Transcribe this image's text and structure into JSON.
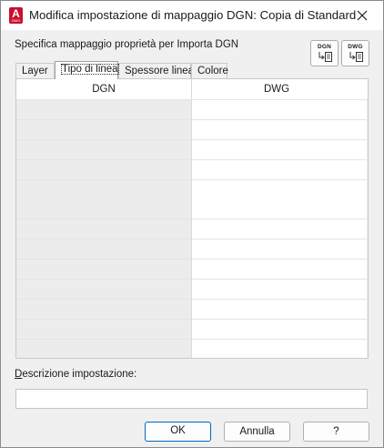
{
  "window": {
    "title": "Modifica impostazione di mappaggio DGN: Copia di Standard",
    "app_icon": "autocad-icon",
    "app_icon_letter": "A",
    "app_icon_sub": "DWG",
    "close_icon": "close-icon"
  },
  "section_label": "Specifica mappaggio proprietà per Importa DGN",
  "toolbar": {
    "dgn_button_label": "DGN",
    "dwg_button_label": "DWG"
  },
  "tabs": [
    {
      "label": "Layer",
      "active": false
    },
    {
      "label": "Tipo di linea",
      "active": true
    },
    {
      "label": "Spessore linea",
      "active": false
    },
    {
      "label": "Colore",
      "active": false
    }
  ],
  "grid": {
    "columns": [
      "DGN",
      "DWG"
    ],
    "rows": [
      [
        "",
        ""
      ],
      [
        "",
        ""
      ],
      [
        "",
        ""
      ],
      [
        "",
        ""
      ],
      [
        "",
        ""
      ],
      [
        "",
        ""
      ],
      [
        "",
        ""
      ],
      [
        "",
        ""
      ],
      [
        "",
        ""
      ],
      [
        "",
        ""
      ],
      [
        "",
        ""
      ],
      [
        "",
        ""
      ],
      [
        "",
        ""
      ]
    ]
  },
  "description": {
    "label_accel": "D",
    "label_rest": "escrizione impostazione:",
    "value": ""
  },
  "buttons": {
    "ok": "OK",
    "cancel": "Annulla",
    "help": "?"
  },
  "colors": {
    "accent": "#0067c0",
    "app_icon": "#c8102e"
  }
}
